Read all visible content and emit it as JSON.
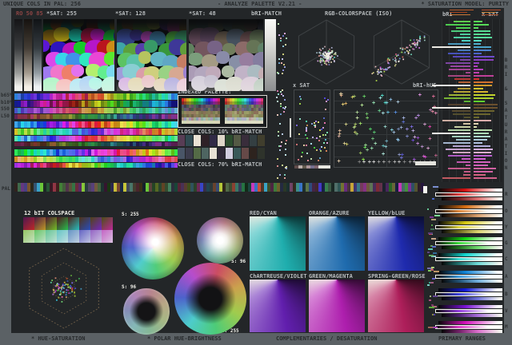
{
  "app": {
    "title_left": "UNIQUE COLS IN PAL: 256",
    "title_center": "- ANALYZE PALETTE V2.21 -",
    "title_right": "* SATURATION MODEL: PURITY"
  },
  "colors": {
    "frame": "#5b6165",
    "background": "#232628",
    "panel_line": "#45494b",
    "text_light": "#b7bbbd",
    "text_dark": "#272a2c",
    "readout_red": "#8a4444",
    "white": "#f1f1ea"
  },
  "header": {
    "rgb_readout": "RO 50 85",
    "sat_labels": [
      "*SAT: 255",
      "*SAT: 128",
      "*SAT: 48"
    ],
    "bri_match": "bRI-MATCH",
    "colorspace_title": "RGB-COLORSPACE (ISO)",
    "bars_left": "bRI",
    "bars_right": "x SAT"
  },
  "stripe_rows": {
    "labels": [
      "b65%",
      "b10%",
      "S50",
      "L50"
    ]
  },
  "pal_label": "PAL",
  "indexed": {
    "title": "INDEXED PALETTE:",
    "close_10": "CLOSE COLS: 10% bRI-MATCH",
    "close_70": "CLOSE COLS: 70% bRI-MATCH"
  },
  "scatter": {
    "sat_label": "x SAT",
    "bri_hue_label": "bRI-hUE"
  },
  "colspace12": {
    "title": "12 bIT COLSPACE"
  },
  "polar": {
    "labels": [
      "S: 255",
      "S: 96",
      "S: 96",
      "S: 255"
    ]
  },
  "complementaries": {
    "panels": [
      {
        "label": "RED/CYAN",
        "hues": [
          0,
          180
        ]
      },
      {
        "label": "ORANGE/AZURE",
        "hues": [
          28,
          208
        ]
      },
      {
        "label": "YELLOW/bLUE",
        "hues": [
          58,
          235
        ]
      },
      {
        "label": "ChARTREUSE/VIOLET",
        "hues": [
          88,
          268
        ]
      },
      {
        "label": "GREEN/MAGENTA",
        "hues": [
          120,
          300
        ]
      },
      {
        "label": "SPRING-GREEN/ROSE",
        "hues": [
          150,
          335
        ]
      }
    ]
  },
  "primary_ranges": {
    "letters": [
      "R",
      "O",
      "Y",
      "G",
      "C",
      "A",
      "B",
      "V",
      "M"
    ],
    "hues": [
      0,
      28,
      56,
      120,
      178,
      205,
      238,
      272,
      308
    ]
  },
  "footer": {
    "hue_saturation": "* HUE-SATURATION",
    "polar_hue_brightness": "* POLAR HUE-BRIGHTNESS",
    "complementaries": "COMPLEMENTARIES / DESATURATION",
    "primary_ranges": "PRIMARY RANGES"
  },
  "sidebar_right": "BRI & SATURATION"
}
